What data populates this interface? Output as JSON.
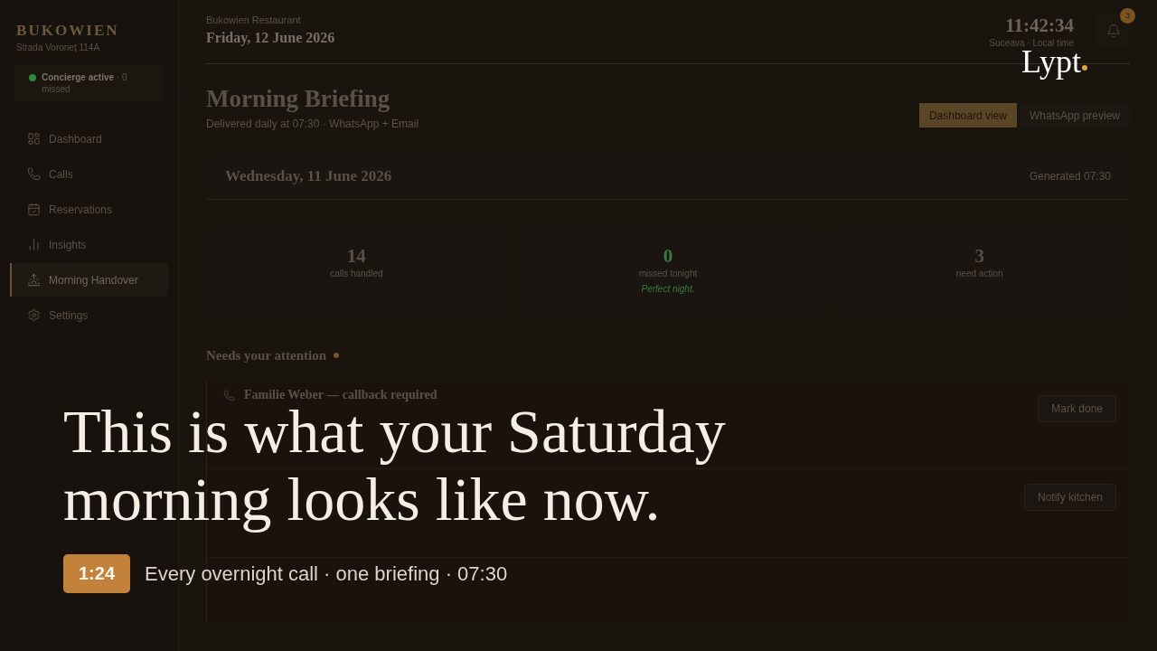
{
  "sidebar": {
    "brand": "BUKOWIEN",
    "address": "Strada Voroneț 114A",
    "status": "**Concierge active** · 0 missed",
    "items": [
      {
        "label": "Dashboard",
        "selected": false
      },
      {
        "label": "Calls",
        "selected": false
      },
      {
        "label": "Reservations",
        "selected": false
      },
      {
        "label": "Insights",
        "selected": false
      },
      {
        "label": "Morning Handover",
        "selected": true
      },
      {
        "label": "Settings",
        "selected": false
      }
    ]
  },
  "header": {
    "venue": "Bukowien Restaurant",
    "date": "Friday, 12 June 2026",
    "clock": "11:42:34",
    "clock_caption": "Suceava · Local time",
    "notifications": "3"
  },
  "page": {
    "title": "Morning Briefing",
    "subtitle": "Delivered daily at 07:30 · WhatsApp + Email",
    "tabs": [
      {
        "label": "Dashboard view",
        "selected": true
      },
      {
        "label": "WhatsApp preview",
        "selected": false
      }
    ]
  },
  "briefing": {
    "date": "Wednesday, 11 June 2026",
    "generated": "Generated 07:30",
    "stats": [
      {
        "value": "14",
        "label": "calls handled",
        "color": "#5a4f45"
      },
      {
        "value": "0",
        "label": "missed tonight",
        "note": "Perfect night.",
        "color": "#3a7a3c"
      },
      {
        "value": "3",
        "label": "need action",
        "color": "#5a4f45"
      }
    ]
  },
  "attention": {
    "title": "Needs your attention",
    "alerts": [
      {
        "title": "Familie Weber — callback required",
        "action": "Mark done"
      },
      {
        "action": "Notify kitchen"
      }
    ]
  },
  "overlay": {
    "headline": [
      "This is what your Saturday",
      "morning looks like now."
    ],
    "timestamp": "1:24",
    "caption": "Every overnight call · one briefing · 07:30",
    "logo": "Lypt"
  }
}
